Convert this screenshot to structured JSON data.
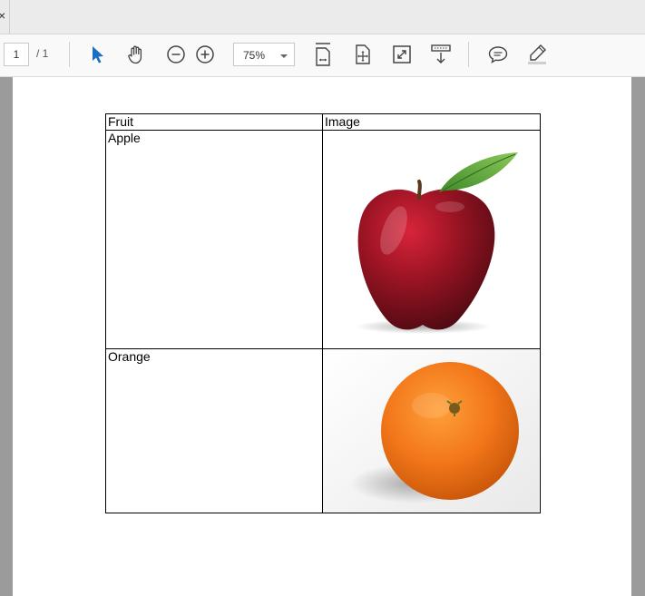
{
  "tabbar": {
    "close_glyph": "×"
  },
  "toolbar": {
    "page_current": "1",
    "page_total_label": "/ 1",
    "zoom_value": "75%",
    "icons": [
      "select-arrow-icon",
      "hand-icon",
      "zoom-out-icon",
      "zoom-in-icon",
      "fit-page-icon",
      "rotate-page-icon",
      "fullscreen-icon",
      "scroll-mode-icon",
      "comment-icon",
      "highlight-icon"
    ],
    "accent_color": "#1b6ec2"
  },
  "table": {
    "headers": [
      "Fruit",
      "Image"
    ],
    "rows": [
      {
        "fruit": "Apple",
        "image": "apple-image"
      },
      {
        "fruit": "Orange",
        "image": "orange-image"
      }
    ]
  }
}
